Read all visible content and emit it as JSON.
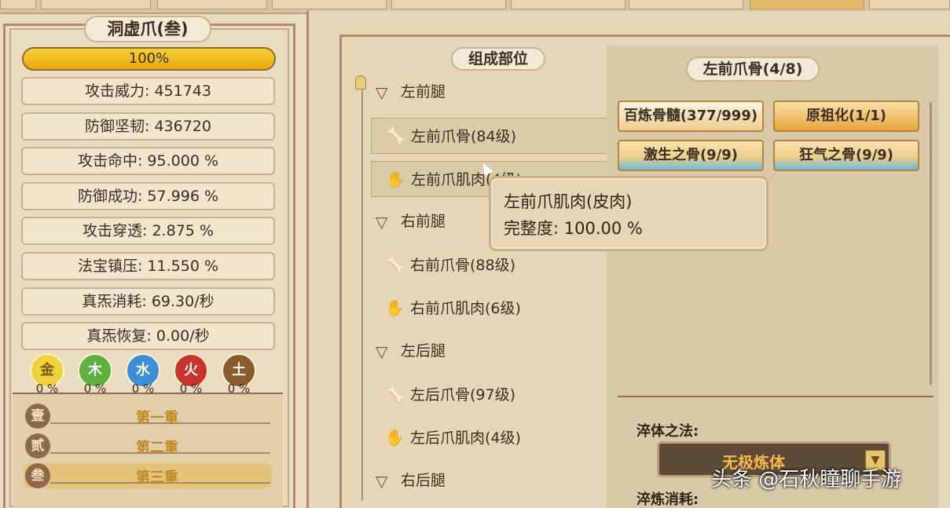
{
  "left_panel": {
    "title": "洞虚爪(叁)",
    "progress_text": "100%",
    "progress_value": 1.0,
    "stats": [
      "攻击威力: 451743",
      "防御坚韧: 436720",
      "攻击命中: 95.000 %",
      "防御成功: 57.996 %",
      "攻击穿透: 2.875 %",
      "法宝镇压: 11.550 %",
      "真炁消耗: 69.30/秒",
      "真炁恢复: 0.00/秒"
    ],
    "elements": [
      {
        "glyph": "金",
        "pct": "0 %",
        "color": "#f0d23c",
        "text_color": "#7a5a10"
      },
      {
        "glyph": "木",
        "pct": "0 %",
        "color": "#5fb03e",
        "text_color": "#ffffff"
      },
      {
        "glyph": "水",
        "pct": "0 %",
        "color": "#3c8fd6",
        "text_color": "#ffffff"
      },
      {
        "glyph": "火",
        "pct": "0 %",
        "color": "#c9332e",
        "text_color": "#ffffff"
      },
      {
        "glyph": "土",
        "pct": "0 %",
        "color": "#8a5a2a",
        "text_color": "#ffffff"
      }
    ],
    "levels": [
      {
        "badge": "壹",
        "label": "第一重"
      },
      {
        "badge": "贰",
        "label": "第二重"
      },
      {
        "badge": "叁",
        "label": "第三重"
      }
    ]
  },
  "tree": {
    "title": "组成部位",
    "groups": [
      {
        "label": "左前腿",
        "items": [
          {
            "icon": "bone-icon",
            "glyph": "🦴",
            "label": "左前爪骨(84级)"
          },
          {
            "icon": "claw-icon",
            "glyph": "✋",
            "label": "左前爪肌肉(4级)"
          }
        ]
      },
      {
        "label": "右前腿",
        "items": [
          {
            "icon": "bone-icon",
            "glyph": "🦴",
            "label": "右前爪骨(88级)"
          },
          {
            "icon": "claw-icon",
            "glyph": "✋",
            "label": "右前爪肌肉(6级)"
          }
        ]
      },
      {
        "label": "左后腿",
        "items": [
          {
            "icon": "bone-icon",
            "glyph": "🦴",
            "label": "左后爪骨(97级)"
          },
          {
            "icon": "claw-icon",
            "glyph": "✋",
            "label": "左后爪肌肉(4级)"
          }
        ]
      },
      {
        "label": "右后腿",
        "items": []
      }
    ]
  },
  "detail": {
    "title": "左前爪骨(4/8)",
    "materials": [
      {
        "label": "百炼骨髓(377/999)",
        "style": "cream"
      },
      {
        "label": "原祖化(1/1)",
        "style": "gold"
      },
      {
        "label": "激生之骨(9/9)",
        "style": "blue"
      },
      {
        "label": "狂气之骨(9/9)",
        "style": "blue"
      }
    ],
    "cuiti_label": "淬体之法:",
    "cuiti_value": "无极炼体",
    "cuilian_label": "淬炼消耗:"
  },
  "tooltip": {
    "line1": "左前爪肌肉(皮肉)",
    "line2": "完整度:  100.00 %"
  },
  "watermark": "头条 @石秋瞳聊手游"
}
